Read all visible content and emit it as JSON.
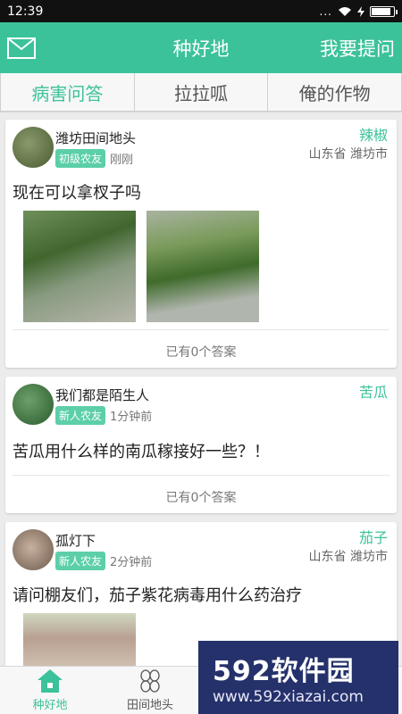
{
  "status": {
    "time": "12:39",
    "dots": "...",
    "battery_level": 0.9
  },
  "header": {
    "title": "种好地",
    "ask_button": "我要提问",
    "accent_color": "#3cc29a"
  },
  "tabs": [
    {
      "label": "病害问答",
      "active": true
    },
    {
      "label": "拉拉呱",
      "active": false
    },
    {
      "label": "俺的作物",
      "active": false
    }
  ],
  "posts": [
    {
      "user": "潍坊田间地头",
      "level": "初级农友",
      "time": "刚刚",
      "crop": "辣椒",
      "location": "山东省 潍坊市",
      "question": "现在可以拿杈子吗",
      "answers": "已有0个答案"
    },
    {
      "user": "我们都是陌生人",
      "level": "新人农友",
      "time": "1分钟前",
      "crop": "苦瓜",
      "location": "",
      "question": "苦瓜用什么样的南瓜稼接好一些？！",
      "answers": "已有0个答案"
    },
    {
      "user": "孤灯下",
      "level": "新人农友",
      "time": "2分钟前",
      "crop": "茄子",
      "location": "山东省 潍坊市",
      "question": "请问棚友们，茄子紫花病毒用什么药治疗"
    }
  ],
  "bottom_nav": [
    {
      "label": "种好地",
      "icon": "house-icon",
      "active": true
    },
    {
      "label": "田间地头",
      "icon": "clover-icon",
      "active": false
    }
  ],
  "watermark": {
    "line1": "592软件园",
    "line2": "www.592xiazai.com"
  }
}
